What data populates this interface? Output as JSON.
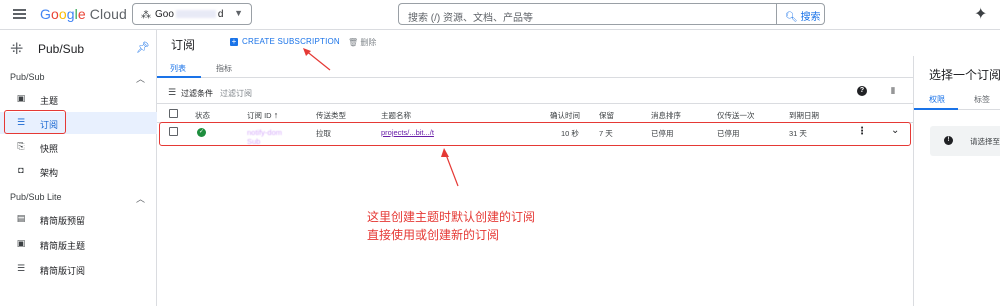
{
  "topbar": {
    "logo_google": [
      "G",
      "o",
      "o",
      "g",
      "l",
      "e"
    ],
    "logo_cloud": "Cloud",
    "project_prefix": "Goo",
    "project_suffix": "d",
    "search_placeholder": "搜索 (/) 资源、文档、产品等",
    "search_button": "搜索",
    "icons": [
      "menu-icon",
      "project-icon",
      "search-icon",
      "gemini-icon"
    ]
  },
  "sidebar": {
    "title": "Pub/Sub",
    "section1": "Pub/Sub",
    "items1": [
      {
        "icon": "▣",
        "label": "主题"
      },
      {
        "icon": "☰",
        "label": "订阅"
      },
      {
        "icon": "⎘",
        "label": "快照"
      },
      {
        "icon": "◘",
        "label": "架构"
      }
    ],
    "section2": "Pub/Sub Lite",
    "items2": [
      {
        "icon": "▤",
        "label": "精简版预留"
      },
      {
        "icon": "▣",
        "label": "精简版主题"
      },
      {
        "icon": "☰",
        "label": "精简版订阅"
      }
    ]
  },
  "header": {
    "title": "订阅",
    "create_label": "CREATE SUBSCRIPTION",
    "delete_label": "删除"
  },
  "tabs": [
    "列表",
    "指标"
  ],
  "filter": {
    "label": "过滤条件",
    "placeholder": "过滤订阅"
  },
  "table": {
    "headers": [
      "状态",
      "订阅 ID",
      "传送类型",
      "主题名称",
      "确认时间",
      "保留",
      "消息排序",
      "仅传送一次",
      "到期日期"
    ],
    "sort_arrow": "↑",
    "row": {
      "id_line1": "notify-dom",
      "id_line2": "Sub",
      "delivery": "拉取",
      "topic": "projects/...bit.../t",
      "ack": "10 秒",
      "retention": "7 天",
      "ordering": "已停用",
      "exactly_once": "已停用",
      "expiry": "31 天"
    }
  },
  "right_panel": {
    "title": "选择一个订阅",
    "tabs": [
      "权限",
      "标签"
    ],
    "info": "请选择至"
  },
  "annotation": {
    "line1": "这里创建主题时默认创建的订阅",
    "line2": "直接使用或创建新的订阅"
  },
  "colors": {
    "accent": "#1a73e8",
    "annotation": "#e53935",
    "ok": "#1e8e3e"
  }
}
